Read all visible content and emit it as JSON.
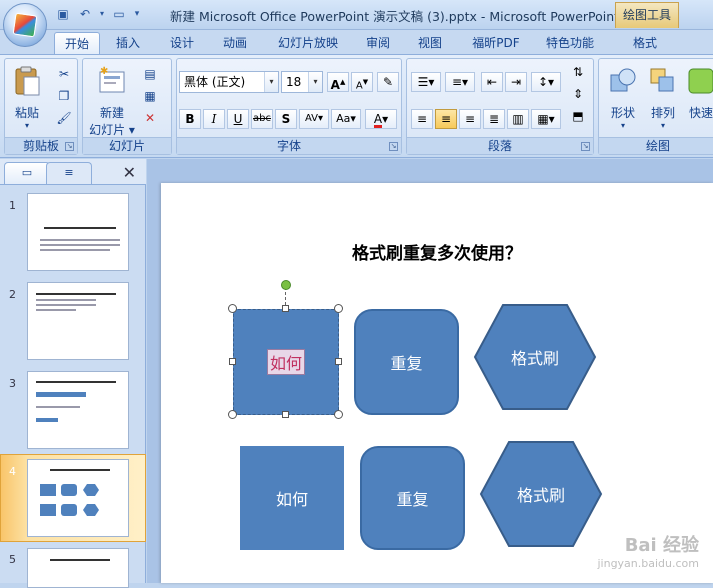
{
  "titlebar": {
    "doc_title": "新建 Microsoft Office PowerPoint 演示文稿 (3).pptx - Microsoft PowerPoint",
    "context_tab": "绘图工具",
    "qat_icons": [
      "save-icon",
      "undo-icon",
      "dropdown-icon",
      "open-icon",
      "customize-icon"
    ]
  },
  "tabs": [
    "开始",
    "插入",
    "设计",
    "动画",
    "幻灯片放映",
    "审阅",
    "视图",
    "福昕PDF",
    "特色功能",
    "格式"
  ],
  "ribbon": {
    "clipboard": {
      "label": "剪贴板",
      "paste": "粘贴"
    },
    "slides": {
      "label": "幻灯片",
      "new_slide_line1": "新建",
      "new_slide_line2": "幻灯片 ▾"
    },
    "font": {
      "label": "字体",
      "font_name": "黑体 (正文)",
      "font_size": "18",
      "bold": "B",
      "italic": "I",
      "underline": "U",
      "strike": "abc",
      "shadow": "S",
      "spacing": "AV",
      "case": "Aa",
      "color": "A",
      "grow": "A",
      "shrink": "A"
    },
    "paragraph": {
      "label": "段落"
    },
    "drawing": {
      "label": "绘图",
      "shapes": "形状",
      "arrange": "排列",
      "quick_styles": "快速"
    }
  },
  "accent_colors": {
    "shape_fill": "#4f81bd",
    "ribbon_bg": "#d4e3f7",
    "rotate_handle": "#7ac043"
  },
  "thumbnails": [
    {
      "num": "1"
    },
    {
      "num": "2"
    },
    {
      "num": "3"
    },
    {
      "num": "4"
    },
    {
      "num": "5"
    }
  ],
  "slide": {
    "title": "格式刷重复多次使用？",
    "row1": [
      {
        "text": "如何"
      },
      {
        "text": "重复"
      },
      {
        "text": "格式刷"
      }
    ],
    "row2": [
      {
        "text": "如何"
      },
      {
        "text": "重复"
      },
      {
        "text": "格式刷"
      }
    ]
  },
  "watermark": {
    "line1": "Bai 经验",
    "line2": "jingyan.baidu.com"
  }
}
